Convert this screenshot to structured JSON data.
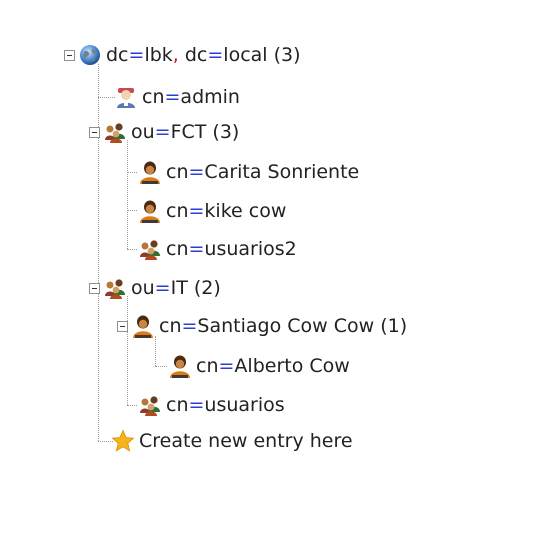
{
  "tree": {
    "root": {
      "label_a": "dc",
      "eq1": "=",
      "label_b": "lbk",
      "comma": ",",
      "label_c": " dc",
      "eq2": "=",
      "label_d": "local (3)"
    },
    "admin": {
      "pre": "cn",
      "eq": "=",
      "post": "admin"
    },
    "fct": {
      "pre": "ou",
      "eq": "=",
      "post": "FCT (3)"
    },
    "carita": {
      "pre": "cn",
      "eq": "=",
      "post": "Carita Sonriente"
    },
    "kike": {
      "pre": "cn",
      "eq": "=",
      "post": "kike cow"
    },
    "usuarios2": {
      "pre": "cn",
      "eq": "=",
      "post": "usuarios2"
    },
    "it": {
      "pre": "ou",
      "eq": "=",
      "post": "IT (2)"
    },
    "santiago": {
      "pre": "cn",
      "eq": "=",
      "post": "Santiago Cow Cow (1)"
    },
    "alberto": {
      "pre": "cn",
      "eq": "=",
      "post": "Alberto Cow"
    },
    "usuarios": {
      "pre": "cn",
      "eq": "=",
      "post": "usuarios"
    },
    "create": {
      "label": "Create new entry here"
    }
  },
  "icons": {
    "root": "globe-icon",
    "admin": "admin-user-icon",
    "ou": "organizational-unit-icon",
    "person": "person-icon",
    "group": "group-icon",
    "create": "star-icon"
  }
}
